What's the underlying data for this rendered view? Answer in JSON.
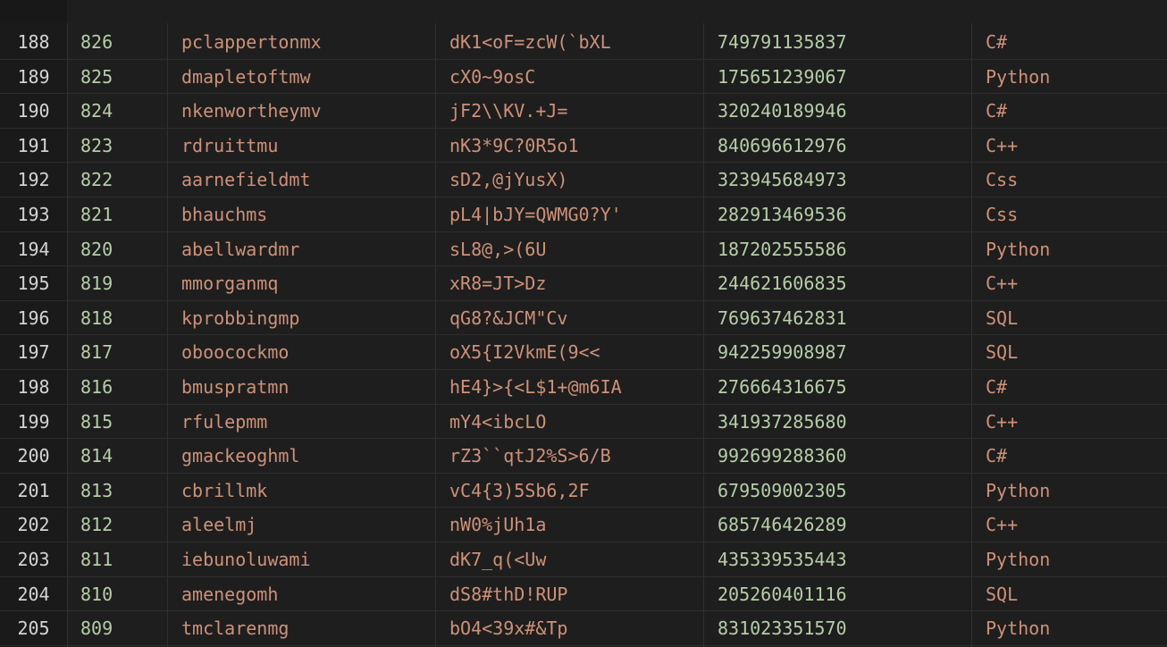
{
  "rows": [
    {
      "line": "188",
      "id": "826",
      "user": "pclappertonmx",
      "pass": "dK1<oF=zcW(`bXL",
      "num": "749791135837",
      "lang": "C#"
    },
    {
      "line": "189",
      "id": "825",
      "user": "dmapletoftmw",
      "pass": "cX0~9osC",
      "num": "175651239067",
      "lang": "Python"
    },
    {
      "line": "190",
      "id": "824",
      "user": "nkenwortheymv",
      "pass": "jF2\\\\KV.+J=",
      "num": "320240189946",
      "lang": "C#"
    },
    {
      "line": "191",
      "id": "823",
      "user": "rdruittmu",
      "pass": "nK3*9C?0R5o1",
      "num": "840696612976",
      "lang": "C++"
    },
    {
      "line": "192",
      "id": "822",
      "user": "aarnefieldmt",
      "pass": "sD2,@jYusX)",
      "num": "323945684973",
      "lang": "Css"
    },
    {
      "line": "193",
      "id": "821",
      "user": "bhauchms",
      "pass": "pL4|bJY=QWMG0?Y'",
      "num": "282913469536",
      "lang": "Css"
    },
    {
      "line": "194",
      "id": "820",
      "user": "abellwardmr",
      "pass": "sL8@,>(6U",
      "num": "187202555586",
      "lang": "Python"
    },
    {
      "line": "195",
      "id": "819",
      "user": "mmorganmq",
      "pass": "xR8=JT>Dz",
      "num": "244621606835",
      "lang": "C++"
    },
    {
      "line": "196",
      "id": "818",
      "user": "kprobbingmp",
      "pass": "qG8?&JCM\"Cv",
      "num": "769637462831",
      "lang": "SQL"
    },
    {
      "line": "197",
      "id": "817",
      "user": "oboocockmo",
      "pass": "oX5{I2VkmE(9<<",
      "num": "942259908987",
      "lang": "SQL"
    },
    {
      "line": "198",
      "id": "816",
      "user": "bmuspratmn",
      "pass": "hE4}>{<L$1+@m6IA",
      "num": "276664316675",
      "lang": "C#"
    },
    {
      "line": "199",
      "id": "815",
      "user": "rfulepmm",
      "pass": "mY4<ibcLO",
      "num": "341937285680",
      "lang": "C++"
    },
    {
      "line": "200",
      "id": "814",
      "user": "gmackeoghml",
      "pass": "rZ3``qtJ2%S>6/B",
      "num": "992699288360",
      "lang": "C#"
    },
    {
      "line": "201",
      "id": "813",
      "user": "cbrillmk",
      "pass": "vC4{3)5Sb6,2F",
      "num": "679509002305",
      "lang": "Python"
    },
    {
      "line": "202",
      "id": "812",
      "user": "aleelmj",
      "pass": "nW0%jUh1a",
      "num": "685746426289",
      "lang": "C++"
    },
    {
      "line": "203",
      "id": "811",
      "user": "iebunoluwami",
      "pass": "dK7_q(<Uw",
      "num": "435339535443",
      "lang": "Python"
    },
    {
      "line": "204",
      "id": "810",
      "user": "amenegomh",
      "pass": "dS8#thD!RUP",
      "num": "205260401116",
      "lang": "SQL"
    },
    {
      "line": "205",
      "id": "809",
      "user": "tmclarenmg",
      "pass": "bO4<39x#&Tp",
      "num": "831023351570",
      "lang": "Python"
    }
  ]
}
